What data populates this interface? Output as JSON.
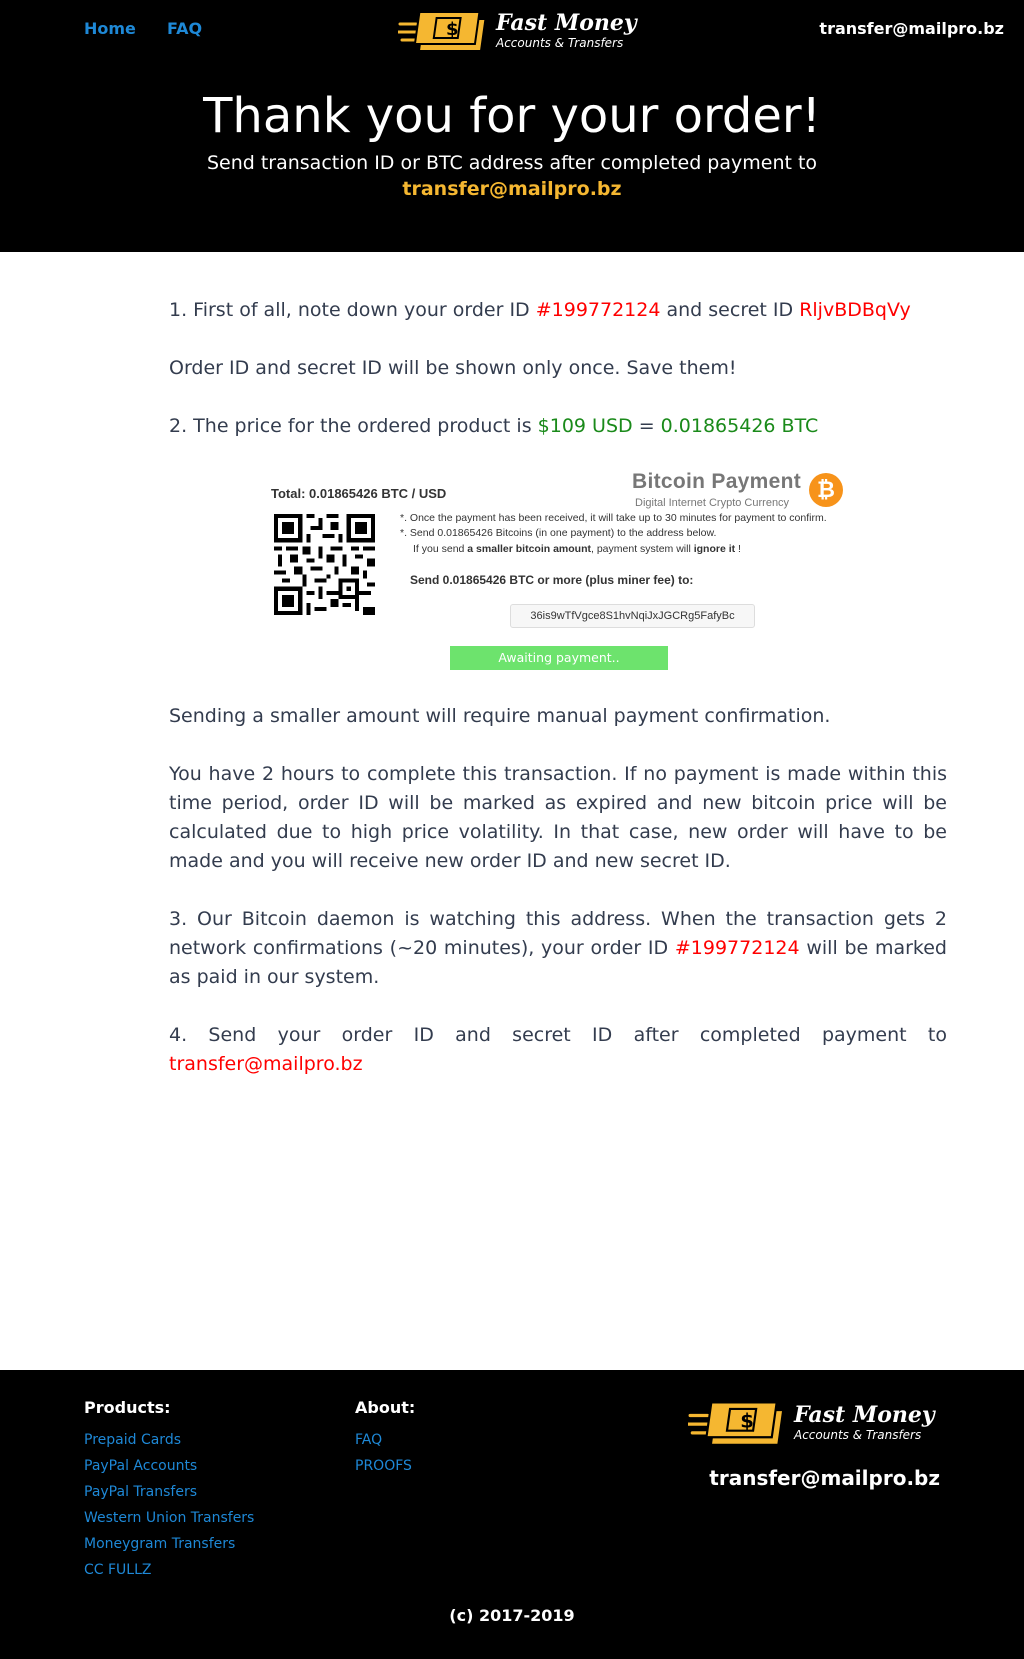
{
  "nav": {
    "home": "Home",
    "faq": "FAQ"
  },
  "header_email": "transfer@mailpro.bz",
  "logo": {
    "name": "Fast Money",
    "tagline": "Accounts & Transfers",
    "symbol": "$"
  },
  "hero": {
    "title": "Thank you for your order!",
    "subtitle": "Send transaction ID or BTC address after completed payment to",
    "email": "transfer@mailpro.bz"
  },
  "steps": {
    "s1_prefix": "1. First of all, note down your order ID",
    "order_id": "#199772124",
    "s1_middle": "and secret ID",
    "secret_id": "RljvBDBqVy",
    "save_note": "Order ID and secret ID will be shown only once. Save them!",
    "s2_prefix": "2. The price for the ordered product is",
    "price_usd": "$109 USD",
    "equals": "=",
    "price_btc": "0.01865426 BTC",
    "smaller_amount": "Sending a smaller amount will require manual payment confirmation.",
    "time_limit": "You have 2 hours to complete this transaction. If no payment is made within this time period, order ID will be marked as expired and new bitcoin price will be calculated due to high price volatility. In that case, new order will have to be made and you will receive new order ID and new secret ID.",
    "s3_prefix": "3. Our Bitcoin daemon is watching this address. When the transaction gets 2 network confirmations (~20 minutes), your order ID",
    "s3_suffix": "will be marked as paid in our system.",
    "s4_prefix": "4. Send your order ID and secret ID after completed payment to",
    "s4_email": "transfer@mailpro.bz"
  },
  "payment_widget": {
    "total": "Total: 0.01865426 BTC / USD",
    "brand_title": "Bitcoin Payment",
    "brand_sub": "Digital Internet Crypto Currency",
    "btc_symbol": "₿",
    "note1": "*. Once the payment has been received, it will take up to 30 minutes for payment to confirm.",
    "note2": "*. Send 0.01865426 Bitcoins (in one payment) to the address below.",
    "note3_a": "If you send",
    "note3_b": "a smaller bitcoin amount",
    "note3_c": ", payment system will",
    "note3_d": "ignore it",
    "note3_e": "!",
    "send_line": "Send 0.01865426 BTC or more (plus miner fee) to:",
    "address": "36is9wTfVgce8S1hvNqiJxJGCRg5FafyBc",
    "status": "Awaiting payment.."
  },
  "footer": {
    "products_heading": "Products:",
    "products": [
      "Prepaid Cards",
      "PayPal Accounts",
      "PayPal Transfers",
      "Western Union Transfers",
      "Moneygram Transfers",
      "CC FULLZ"
    ],
    "about_heading": "About:",
    "about": [
      "FAQ",
      "PROOFS"
    ],
    "email": "transfer@mailpro.bz",
    "copyright": "(c) 2017-2019"
  },
  "colors": {
    "accent_blue": "#1e88d6",
    "gold": "#f5b731",
    "red": "#ff0000",
    "green": "#1a8a1a",
    "btc_orange": "#f7931a",
    "status_green": "#6de36d"
  }
}
